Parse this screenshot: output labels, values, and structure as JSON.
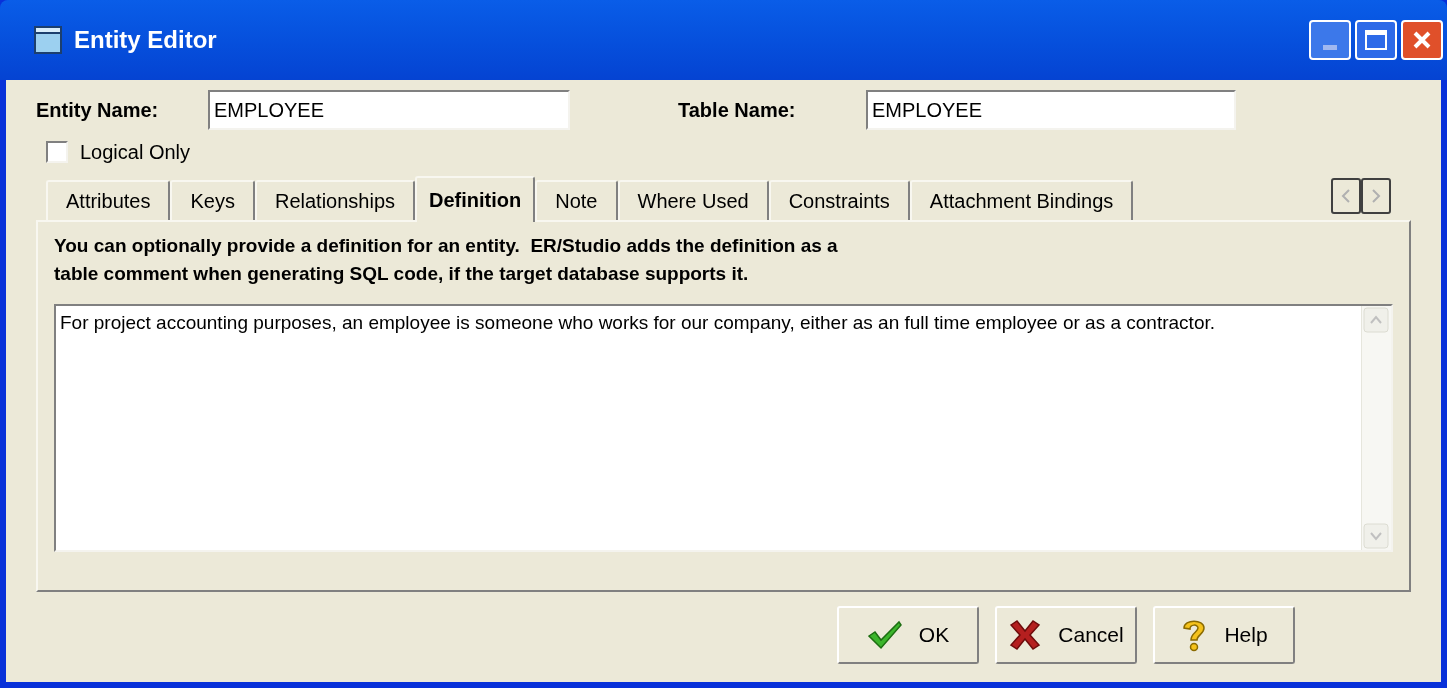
{
  "window": {
    "title": "Entity Editor"
  },
  "entity_name": {
    "label": "Entity Name:",
    "value": "EMPLOYEE"
  },
  "table_name": {
    "label": "Table Name:",
    "value": "EMPLOYEE"
  },
  "logical_only": {
    "label": "Logical Only",
    "checked": false
  },
  "tabs": [
    {
      "label": "Attributes",
      "selected": false
    },
    {
      "label": "Keys",
      "selected": false
    },
    {
      "label": "Relationships",
      "selected": false
    },
    {
      "label": "Definition",
      "selected": true
    },
    {
      "label": "Note",
      "selected": false
    },
    {
      "label": "Where Used",
      "selected": false
    },
    {
      "label": "Constraints",
      "selected": false
    },
    {
      "label": "Attachment Bindings",
      "selected": false
    }
  ],
  "instructions": [
    "You can optionally provide a definition for an entity.  ER/Studio adds the definition as a",
    "table comment when generating SQL code, if the target database supports it."
  ],
  "definition": "For project accounting purposes, an employee is someone who works for our company, either as an full time employee or as a contractor.",
  "buttons": [
    {
      "kind": "ok",
      "label": "OK"
    },
    {
      "kind": "cancel",
      "label": "Cancel"
    },
    {
      "kind": "help",
      "label": "Help"
    }
  ]
}
